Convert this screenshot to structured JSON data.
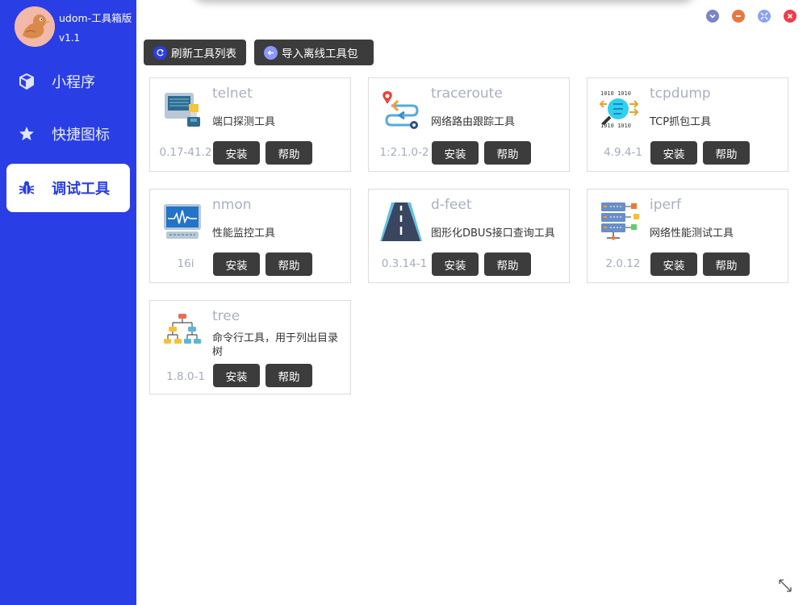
{
  "app": {
    "name": "udom-工具箱版",
    "version": "v1.1"
  },
  "sidebar": {
    "items": [
      {
        "label": "小程序",
        "icon": "cube-icon",
        "active": false
      },
      {
        "label": "快捷图标",
        "icon": "star-icon",
        "active": false
      },
      {
        "label": "调试工具",
        "icon": "bug-icon",
        "active": true
      }
    ]
  },
  "window_controls": [
    {
      "icon": "collapse-icon",
      "color": "#7b84c9"
    },
    {
      "icon": "minimize-icon",
      "color": "#e8773e"
    },
    {
      "icon": "maximize-icon",
      "color": "#8aa2f0"
    },
    {
      "icon": "close-icon",
      "color": "#ef3b4a"
    }
  ],
  "toolbar": {
    "refresh_label": "刷新工具列表",
    "import_label": "导入离线工具包"
  },
  "tools": [
    {
      "name": "telnet",
      "desc": "端口探测工具",
      "version": "0.17-41.2",
      "install": "安装",
      "help": "帮助",
      "icon": "network-port-icon"
    },
    {
      "name": "traceroute",
      "desc": "网络路由跟踪工具",
      "version": "1:2.1.0-2",
      "install": "安装",
      "help": "帮助",
      "icon": "route-icon"
    },
    {
      "name": "tcpdump",
      "desc": "TCP抓包工具",
      "version": "4.9.4-1",
      "install": "安装",
      "help": "帮助",
      "icon": "packet-capture-icon"
    },
    {
      "name": "nmon",
      "desc": "性能监控工具",
      "version": "16i",
      "install": "安装",
      "help": "帮助",
      "icon": "monitor-icon"
    },
    {
      "name": "d-feet",
      "desc": "图形化DBUS接口查询工具",
      "version": "0.3.14-1",
      "install": "安装",
      "help": "帮助",
      "icon": "road-icon"
    },
    {
      "name": "iperf",
      "desc": "网络性能测试工具",
      "version": "2.0.12",
      "install": "安装",
      "help": "帮助",
      "icon": "server-rack-icon"
    },
    {
      "name": "tree",
      "desc": "命令行工具，用于列出目录树",
      "version": "1.8.0-1",
      "install": "安装",
      "help": "帮助",
      "icon": "tree-hierarchy-icon"
    }
  ],
  "colors": {
    "sidebar_bg": "#2a3ee6",
    "button_bg": "#3c3c3c",
    "tool_name": "#aab0bf"
  }
}
